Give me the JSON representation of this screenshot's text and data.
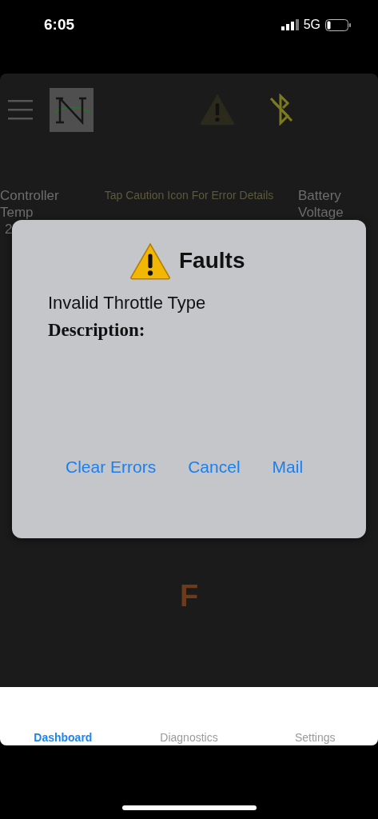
{
  "status_bar": {
    "time": "6:05",
    "network": "5G"
  },
  "header": {
    "caution_text": "Tap Caution Icon For Error Details"
  },
  "gauges": [
    {
      "label": "Controller Temp",
      "value": "2"
    },
    {
      "label": "Battery Voltage"
    }
  ],
  "gear": "F",
  "dialog": {
    "title": "Faults",
    "fault": "Invalid Throttle Type",
    "description_label": "Description:",
    "buttons": [
      "Clear Errors",
      "Cancel",
      "Mail"
    ]
  },
  "tabs": [
    {
      "label": "Dashboard",
      "selected": true
    },
    {
      "label": "Diagnostics",
      "selected": false
    },
    {
      "label": "Settings",
      "selected": false
    }
  ]
}
